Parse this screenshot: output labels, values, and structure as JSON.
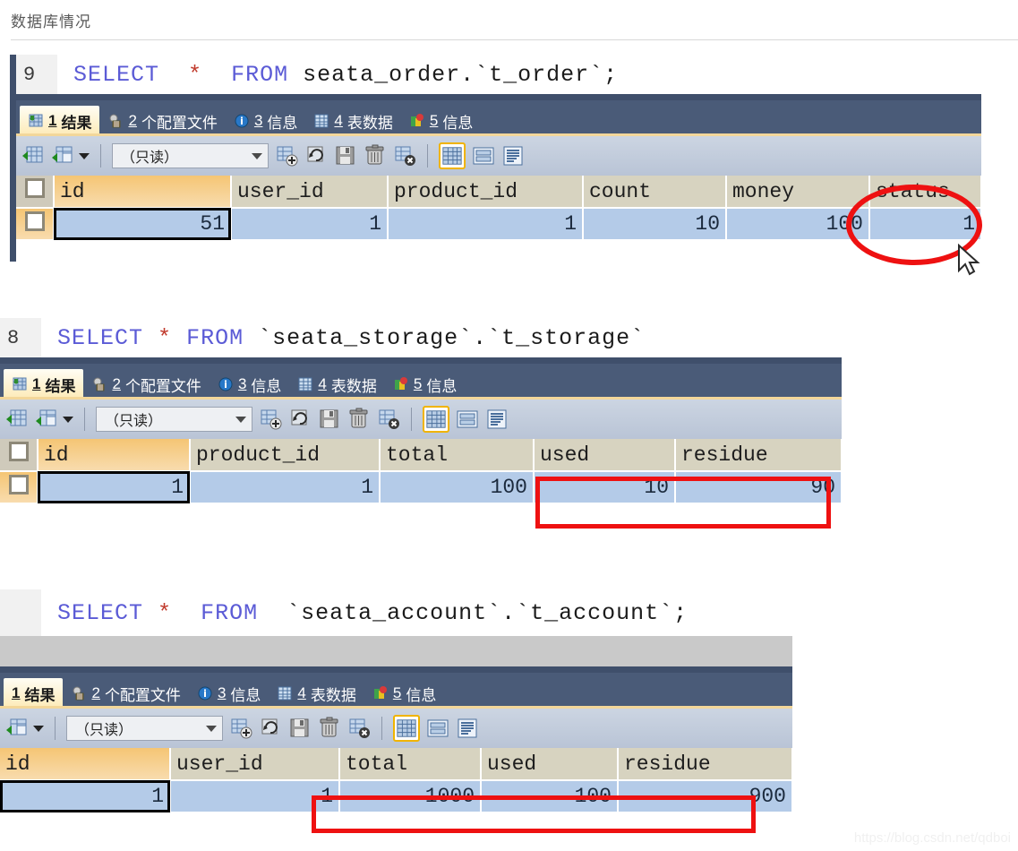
{
  "heading": "数据库情况",
  "watermark": "https://blog.csdn.net/qdboi",
  "tabs_labels": {
    "t1_num": "1",
    "t1_text": "结果",
    "t2_num": "2",
    "t2_text": "个配置文件",
    "t3_num": "3",
    "t3_text": "信息",
    "t4_num": "4",
    "t4_text": "表数据",
    "t5_num": "5",
    "t5_text": "信息"
  },
  "toolbar": {
    "readonly_label": "（只读）",
    "icons": [
      "grid-insert-icon",
      "grid-export-icon",
      "dropdown-caret-icon",
      "add-record-icon",
      "refresh-record-icon",
      "save-record-icon",
      "delete-record-icon",
      "cancel-record-icon",
      "view-grid-icon",
      "view-form-icon",
      "view-text-icon"
    ]
  },
  "blocks": [
    {
      "line_number": "9",
      "sql_kw1": "SELECT",
      "sql_star": "*",
      "sql_kw2": "FROM",
      "sql_rest": " seata_order.`t_order`;",
      "columns": [
        "id",
        "user_id",
        "product_id",
        "count",
        "money",
        "status"
      ],
      "row": [
        "51",
        "1",
        "1",
        "10",
        "100",
        "1"
      ],
      "annotation": "red-ellipse-around-status"
    },
    {
      "line_number": "8",
      "sql_kw1": "SELECT",
      "sql_star": "*",
      "sql_kw2": "FROM",
      "sql_rest": " `seata_storage`.`t_storage`",
      "columns": [
        "id",
        "product_id",
        "total",
        "used",
        "residue"
      ],
      "row": [
        "1",
        "1",
        "100",
        "10",
        "90"
      ],
      "annotation": "red-rect-around-used-residue"
    },
    {
      "line_number": "",
      "sql_kw1": "SELECT",
      "sql_star": "*",
      "sql_kw2": "FROM",
      "sql_rest": "  `seata_account`.`t_account`;",
      "columns": [
        "id",
        "user_id",
        "total",
        "used",
        "residue"
      ],
      "row": [
        "1",
        "1",
        "1000",
        "100",
        "900"
      ],
      "annotation": "red-rect-around-total-used-residue"
    }
  ],
  "colors": {
    "annotation_red": "#ee1111",
    "tabstrip_blue": "#4a5b78",
    "active_tab_yellow": "#fdeab6",
    "header_tan": "#d7d3c0",
    "row_blue": "#b4cbe8",
    "first_col_orange": "#f5c574"
  }
}
